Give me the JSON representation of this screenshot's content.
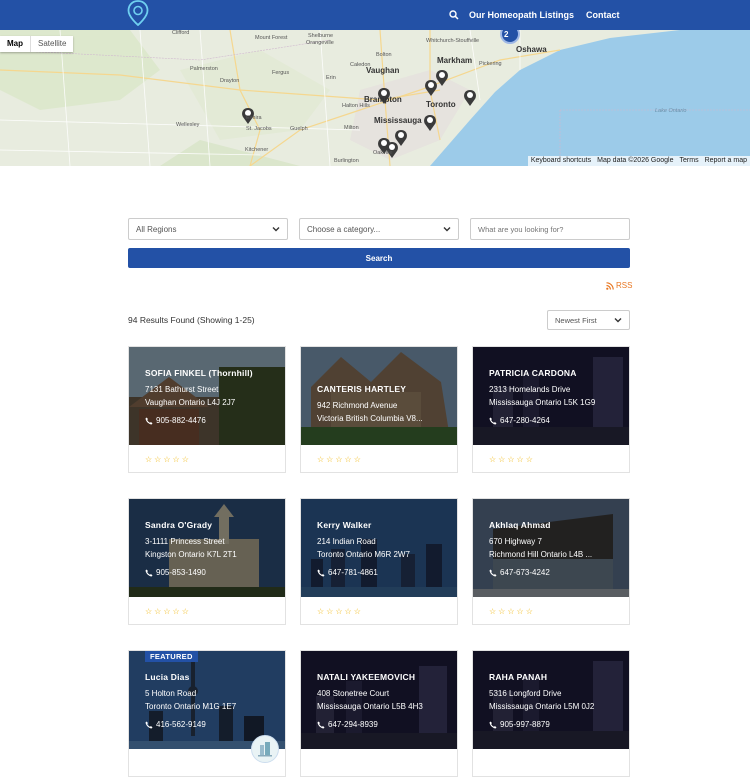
{
  "header": {
    "nav_listings": "Our Homeopath Listings",
    "nav_contact": "Contact",
    "icons": {
      "logo": "map-pin-logo-icon",
      "search": "search-icon"
    }
  },
  "map": {
    "type_map": "Map",
    "type_satellite": "Satellite",
    "footer": {
      "shortcuts": "Keyboard shortcuts",
      "data": "Map data ©2026 Google",
      "terms": "Terms",
      "report": "Report a map"
    },
    "cluster_count": "2",
    "places": {
      "clifford": "Clifford",
      "mount_forest": "Mount Forest",
      "shelburne": "Shelburne",
      "orangeville": "Orangeville",
      "bolton": "Bolton",
      "vaughan": "Vaughan",
      "markham": "Markham",
      "oshawa": "Oshawa",
      "pickering": "Pickering",
      "brampton": "Brampton",
      "toronto": "Toronto",
      "mississauga": "Mississauga",
      "oakville": "Oakville",
      "guelph": "Guelph",
      "kitchener": "Kitchener",
      "elmira": "Elmira",
      "st_jacobs": "St. Jacobs",
      "lake_ontario": "Lake Ontario",
      "palmerston": "Palmerston",
      "drayton": "Drayton",
      "milton": "Milton",
      "fergus": "Fergus",
      "halton_hills": "Halton Hills",
      "whitchurch": "Whitchurch-Stouffville",
      "caledon": "Caledon",
      "erin": "Erin",
      "wellesley": "Wellesley",
      "burlington": "Burlington"
    }
  },
  "search": {
    "region_value": "All Regions",
    "category_placeholder": "Choose a category...",
    "keyword_placeholder": "What are you looking for?",
    "button_label": "Search"
  },
  "rss_label": "RSS",
  "results_label": "94 Results Found (Showing 1-25)",
  "sort_value": "Newest First",
  "listings": [
    {
      "name": "SOFIA FINKEL (Thornhill)",
      "line1": "7131 Bathurst Street",
      "line2": "Vaughan Ontario L4J 2J7",
      "phone": "905-882-4476",
      "stars": "☆☆☆☆☆"
    },
    {
      "name": "CANTERIS HARTLEY",
      "line1": "942 Richmond Avenue",
      "line2": "Victoria British Columbia V8...",
      "phone": "",
      "stars": "☆☆☆☆☆"
    },
    {
      "name": "PATRICIA CARDONA",
      "line1": "2313 Homelands Drive",
      "line2": "Mississauga Ontario L5K 1G9",
      "phone": "647-280-4264",
      "stars": "☆☆☆☆☆"
    },
    {
      "name": "Sandra O'Grady",
      "line1": "3-1111 Princess Street",
      "line2": "Kingston Ontario K7L 2T1",
      "phone": "905-853-1490",
      "stars": "☆☆☆☆☆"
    },
    {
      "name": "Kerry Walker",
      "line1": "214 Indian Road",
      "line2": "Toronto Ontario M6R 2W7",
      "phone": "647-781-4861",
      "stars": "☆☆☆☆☆"
    },
    {
      "name": "Akhlaq Ahmad",
      "line1": "670 Highway 7",
      "line2": "Richmond Hill Ontario L4B ...",
      "phone": "647-673-4242",
      "stars": "☆☆☆☆☆"
    },
    {
      "name": "Lucia Dias",
      "line1": "5 Holton Road",
      "line2": "Toronto Ontario M1G 1E7",
      "phone": "416-562-9149",
      "stars": "",
      "featured": "FEATURED"
    },
    {
      "name": "NATALI YAKEEMOVICH",
      "line1": "408 Stonetree Court",
      "line2": "Mississauga Ontario L5B 4H3",
      "phone": "647-294-8939",
      "stars": ""
    },
    {
      "name": "RAHA PANAH",
      "line1": "5316 Longford Drive",
      "line2": "Mississauga Ontario L5M 0J2",
      "phone": "905-997-8879",
      "stars": ""
    }
  ],
  "colors": {
    "brand": "#2351a6",
    "rss": "#e87722",
    "star": "#f0b400"
  }
}
